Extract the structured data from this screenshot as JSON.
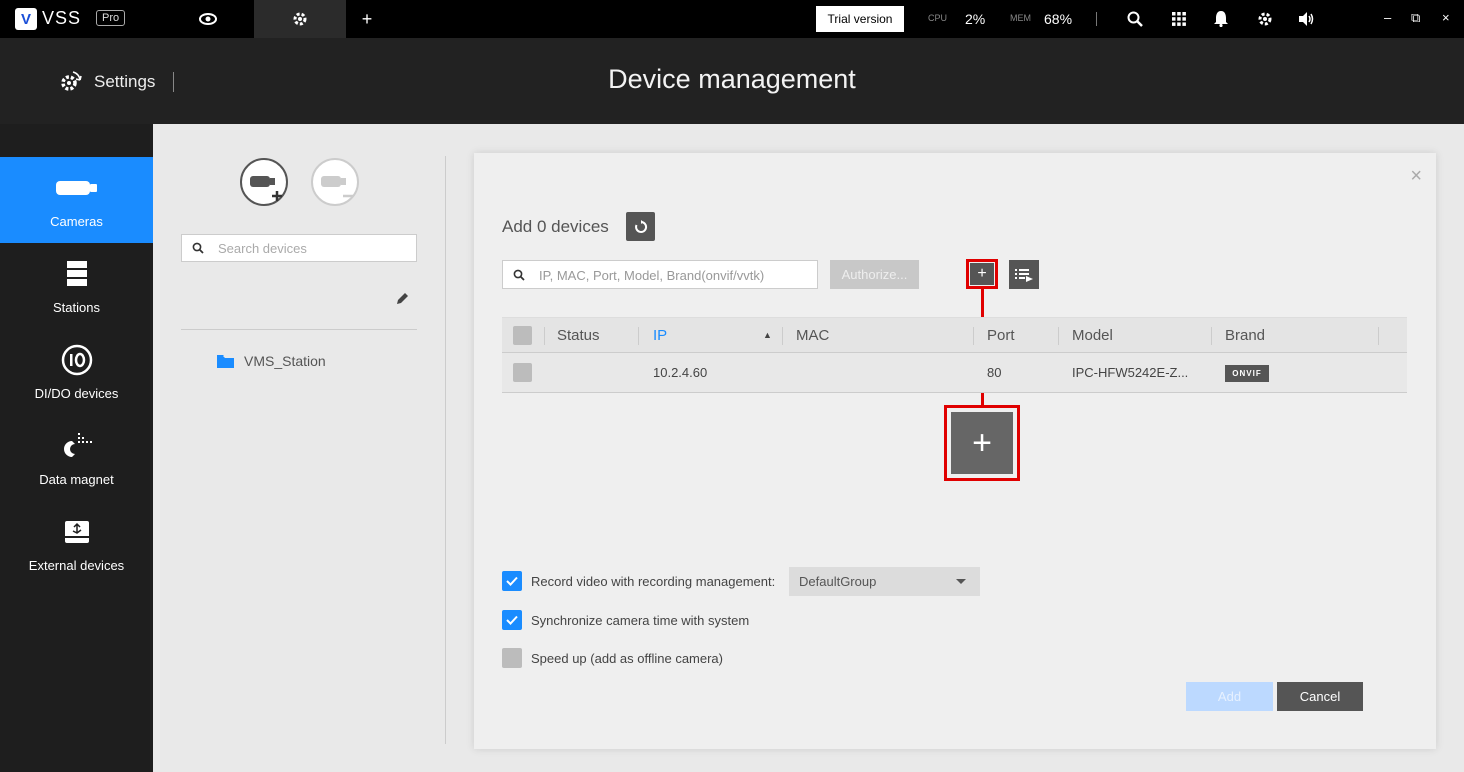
{
  "app": {
    "logo_text": "VSS",
    "logo_badge": "Pro",
    "logo_letter": "V"
  },
  "topbar": {
    "add_tab": "+",
    "trial_label": "Trial version",
    "cpu_label": "CPU",
    "cpu_value": "2%",
    "mem_label": "MEM",
    "mem_value": "68%",
    "minimize": "–",
    "restore": "⧉",
    "close": "×"
  },
  "header": {
    "settings_label": "Settings",
    "page_title": "Device management"
  },
  "nav": {
    "items": [
      {
        "label": "Cameras",
        "icon": "camera-icon",
        "active": true
      },
      {
        "label": "Stations",
        "icon": "station-icon"
      },
      {
        "label": "DI/DO devices",
        "icon": "io-icon"
      },
      {
        "label": "Data magnet",
        "icon": "data-magnet-icon"
      },
      {
        "label": "External devices",
        "icon": "external-device-icon"
      }
    ]
  },
  "tree": {
    "search_placeholder": "Search devices",
    "station_name": "VMS_Station"
  },
  "dialog": {
    "title": "Add 0 devices",
    "filter_placeholder": "IP, MAC, Port, Model, Brand(onvif/vvtk)",
    "authorize_label": "Authorize...",
    "add_small_label": "+",
    "add_zoom_label": "+",
    "close_label": "×",
    "table": {
      "headers": {
        "status": "Status",
        "ip": "IP",
        "mac": "MAC",
        "port": "Port",
        "model": "Model",
        "brand": "Brand"
      },
      "sort_indicator": "▲",
      "rows": [
        {
          "status": "",
          "ip": "10.2.4.60",
          "mac": "",
          "port": "80",
          "model": "IPC-HFW5242E-Z...",
          "brand": "ONVIF"
        }
      ]
    },
    "options": {
      "record_label": "Record video with recording management:",
      "record_group": "DefaultGroup",
      "sync_label": "Synchronize camera time with system",
      "speedup_label": "Speed up (add as offline camera)"
    },
    "add_button": "Add",
    "cancel_button": "Cancel"
  },
  "colors": {
    "accent": "#1a8cff",
    "highlight": "#e00000",
    "topbar": "#000000",
    "nav": "#1e1e1e"
  }
}
